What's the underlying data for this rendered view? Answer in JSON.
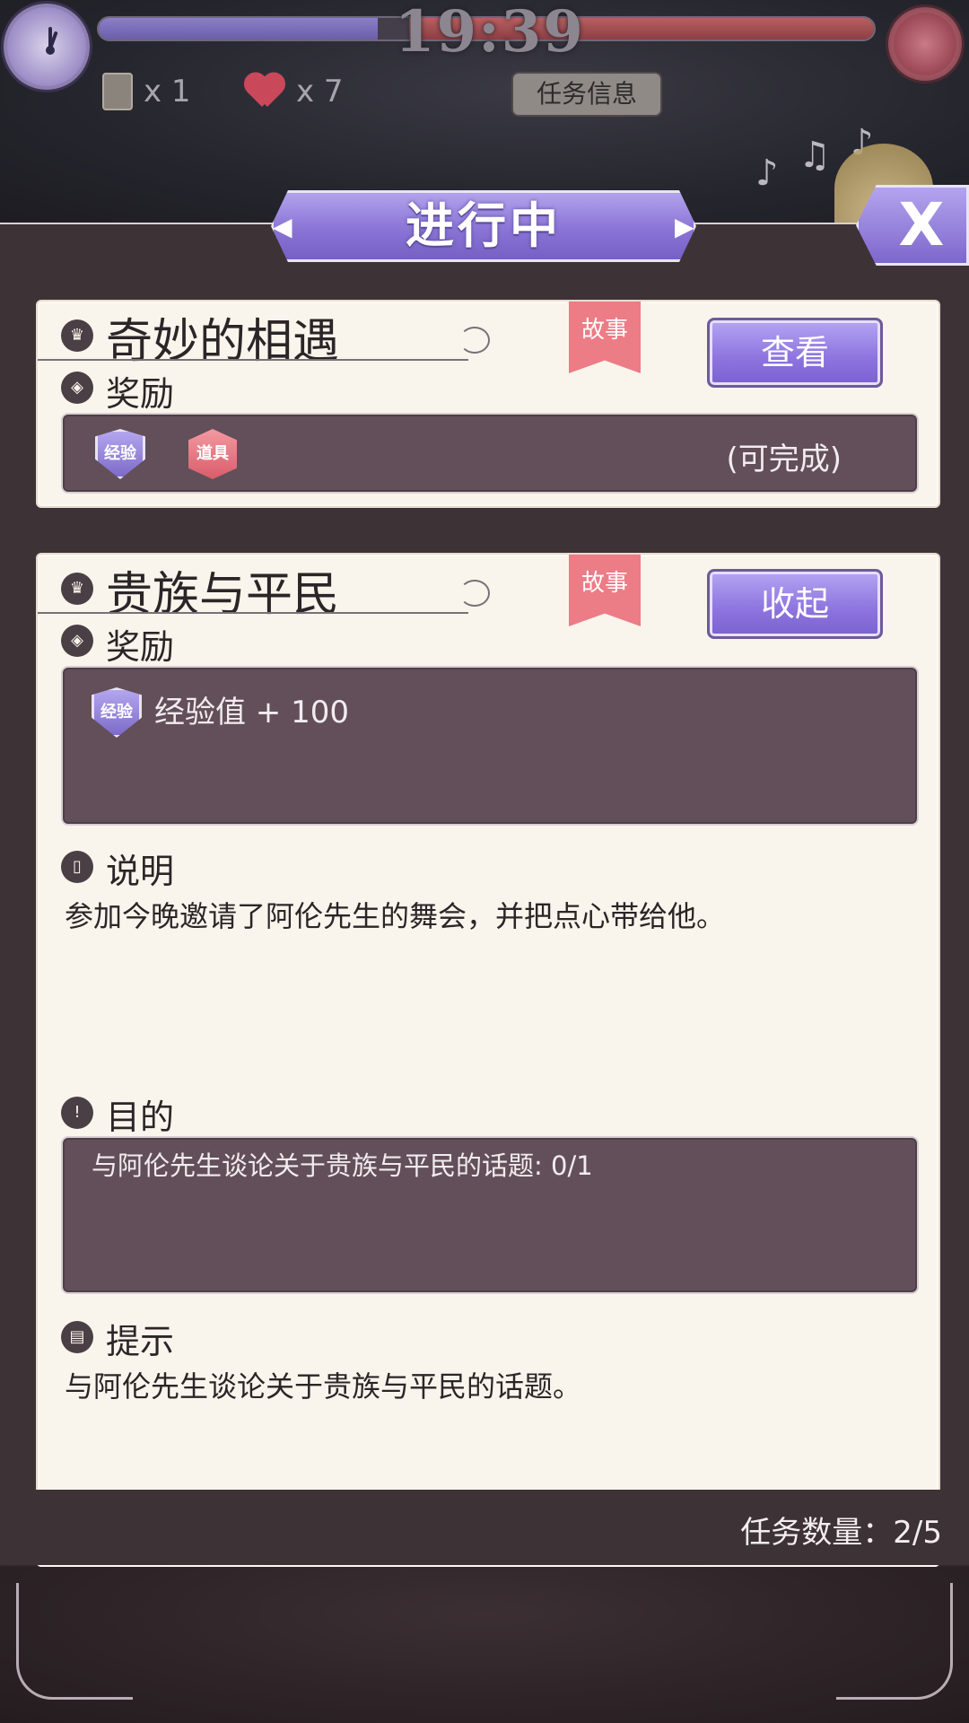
{
  "hud": {
    "time": "19:39",
    "time_progress": 0.36,
    "scroll_count": "x 1",
    "heart_count": "x 7",
    "mission_info_label": "任务信息"
  },
  "header": {
    "title": "进行中",
    "close_label": "X"
  },
  "quests": [
    {
      "title": "奇妙的相遇",
      "tag": "故事",
      "button_label": "查看",
      "reward_label": "奖励",
      "reward_badges": [
        "经验",
        "道具"
      ],
      "reward_status": "(可完成)"
    },
    {
      "title": "贵族与平民",
      "tag": "故事",
      "button_label": "收起",
      "reward_label": "奖励",
      "reward_badge": "经验",
      "reward_text": "经验值 + 100",
      "description_label": "说明",
      "description": "参加今晚邀请了阿伦先生的舞会，并把点心带给他。",
      "objective_label": "目的",
      "objective": "与阿伦先生谈论关于贵族与平民的话题: 0/1",
      "hint_label": "提示",
      "hint": "与阿伦先生谈论关于贵族与平民的话题。"
    }
  ],
  "footer": {
    "quest_count": "任务数量：2/5"
  },
  "colors": {
    "accent_purple": "#8a74d6",
    "tag_pink": "#ec7c86",
    "card_bg": "#faf5ec",
    "box_bg": "#634f59"
  }
}
